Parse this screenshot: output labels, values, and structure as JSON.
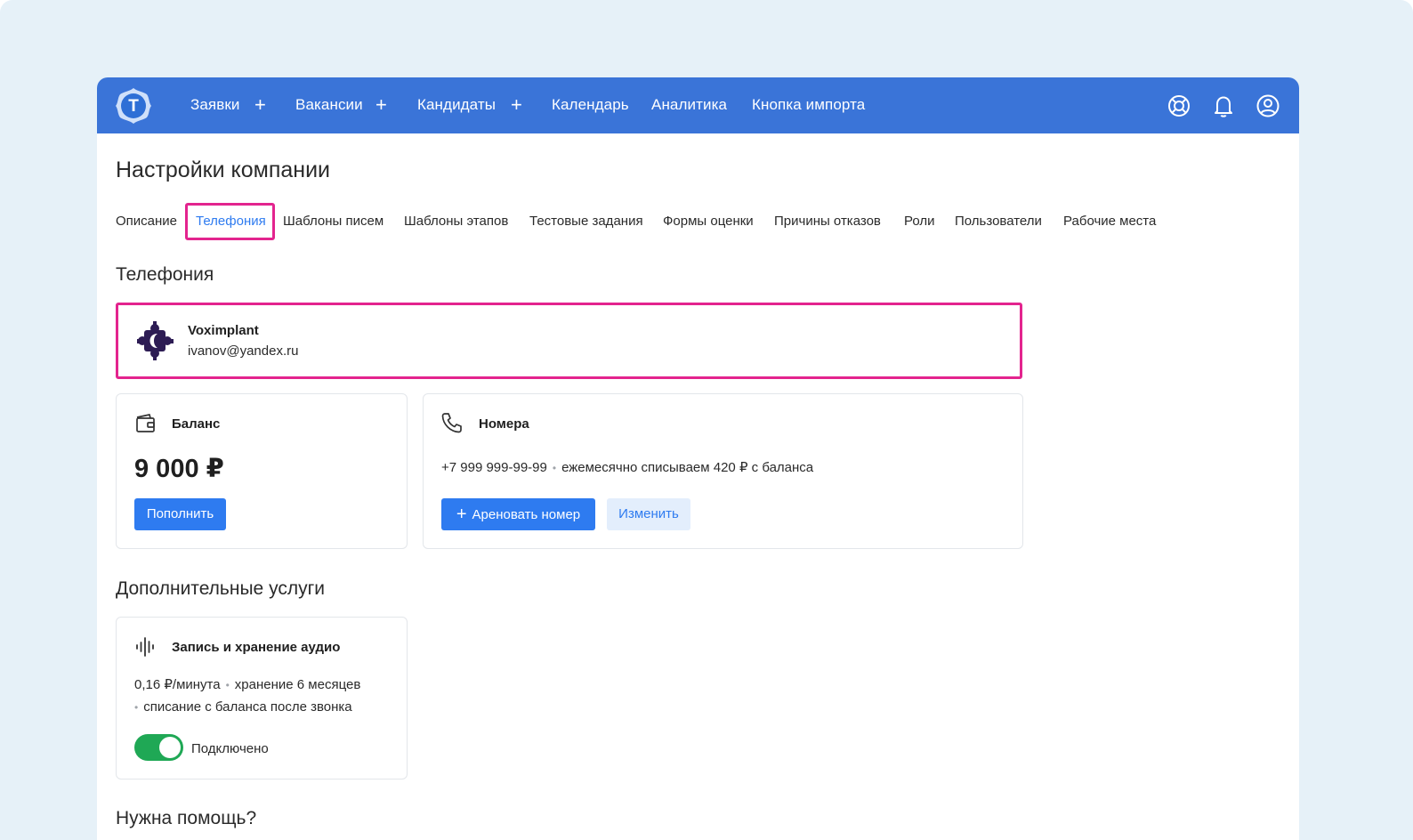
{
  "nav": {
    "items": [
      {
        "label": "Заявки",
        "has_plus": true
      },
      {
        "label": "Вакансии",
        "has_plus": true
      },
      {
        "label": "Кандидаты",
        "has_plus": true
      },
      {
        "label": "Календарь",
        "has_plus": false
      },
      {
        "label": "Аналитика",
        "has_plus": false
      },
      {
        "label": "Кнопка импорта",
        "has_plus": false
      }
    ],
    "plus_symbol": "+",
    "logo_letter": "T",
    "icons": [
      "lifebuoy-icon",
      "bell-icon",
      "user-icon"
    ]
  },
  "page": {
    "title": "Настройки компании"
  },
  "tabs": [
    {
      "label": "Описание",
      "active": false
    },
    {
      "label": "Телефония",
      "active": true
    },
    {
      "label": "Шаблоны писем",
      "active": false
    },
    {
      "label": "Шаблоны этапов",
      "active": false
    },
    {
      "label": "Тестовые задания",
      "active": false
    },
    {
      "label": "Формы оценки",
      "active": false
    },
    {
      "label": "Причины отказов",
      "active": false
    },
    {
      "label": "Роли",
      "active": false
    },
    {
      "label": "Пользователи",
      "active": false
    },
    {
      "label": "Рабочие места",
      "active": false
    }
  ],
  "telephony": {
    "section_title": "Телефония",
    "provider": {
      "name": "Voximplant",
      "email": "ivanov@yandex.ru"
    },
    "balance": {
      "title": "Баланс",
      "amount": "9 000 ₽",
      "button": "Пополнить"
    },
    "numbers": {
      "title": "Номера",
      "phone": "+7 999 999-99-99",
      "note": "ежемесячно списываем 420 ₽ с баланса",
      "rent_button": "Ареновать номер",
      "change_button": "Изменить"
    }
  },
  "extra": {
    "section_title": "Дополнительные услуги",
    "audio": {
      "title": "Запись и хранение аудио",
      "price": "0,16 ₽/минута",
      "storage": "хранение 6 месяцев",
      "billing": "списание с баланса после звонка",
      "status": "Подключено",
      "enabled": true
    }
  },
  "help": {
    "title": "Нужна помощь?"
  },
  "colors": {
    "topbar": "#3a74d8",
    "accent": "#2e7bf0",
    "highlight": "#e3248e",
    "toggle_on": "#1fa855",
    "provider_logo": "#2d1c54"
  }
}
